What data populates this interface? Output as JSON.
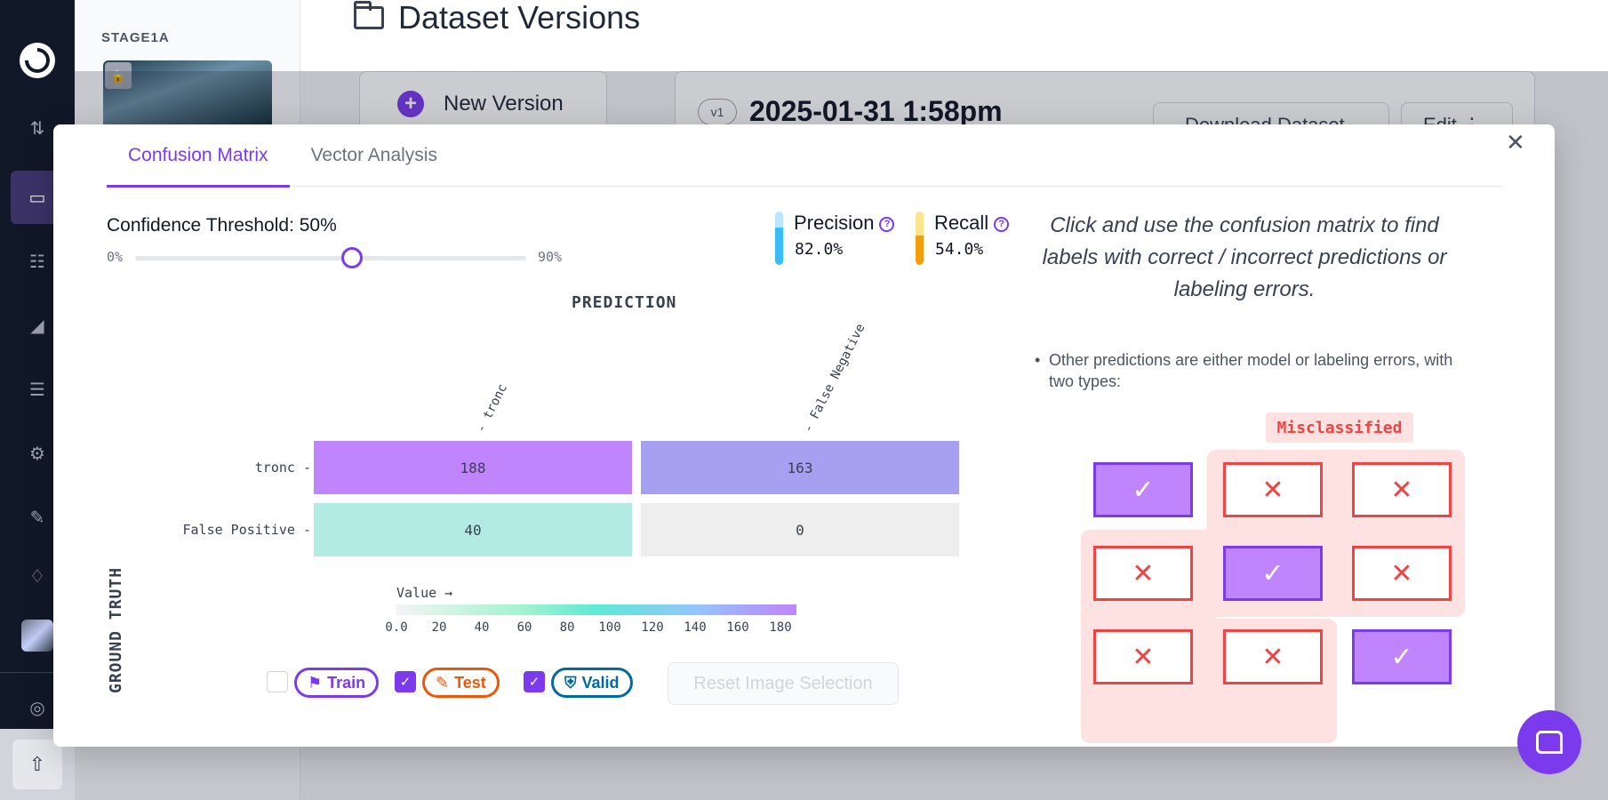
{
  "project": {
    "name": "STAGE1A"
  },
  "page": {
    "title": "Dataset Versions"
  },
  "background": {
    "new_version_label": "New Version",
    "version_badge": "v1",
    "version_date": "2025-01-31 1:58pm",
    "download_label": "Download Dataset",
    "edit_label": "Edit"
  },
  "modal": {
    "tabs": [
      {
        "label": "Confusion Matrix",
        "active": true
      },
      {
        "label": "Vector Analysis",
        "active": false
      }
    ],
    "confidence": {
      "label": "Confidence Threshold: 50%",
      "min_label": "0%",
      "max_label": "90%",
      "value": 50,
      "max": 90
    },
    "precision": {
      "label": "Precision",
      "value": "82.0%",
      "color": "#38bdf8"
    },
    "recall": {
      "label": "Recall",
      "value": "54.0%",
      "color": "#f59e0b"
    },
    "prediction_axis": "PREDICTION",
    "ground_truth_axis": "GROUND TRUTH",
    "scale_label": "Value →",
    "reset_label": "Reset Image Selection",
    "splits": [
      {
        "label": "Train",
        "checked": false,
        "color": "#7c3aed"
      },
      {
        "label": "Test",
        "checked": true,
        "color": "#ea580c"
      },
      {
        "label": "Valid",
        "checked": true,
        "color": "#0369a1"
      }
    ]
  },
  "chart_data": {
    "type": "heatmap",
    "x_labels": [
      "tronc",
      "False Negative"
    ],
    "y_labels": [
      "tronc",
      "False Positive"
    ],
    "values": [
      [
        188,
        163
      ],
      [
        40,
        0
      ]
    ],
    "cell_colors": [
      [
        "#c084fc",
        "#a5a0f0"
      ],
      [
        "#b2ebe3",
        "#eeeeee"
      ]
    ],
    "xlabel": "PREDICTION",
    "ylabel": "GROUND TRUTH",
    "colorbar": {
      "label": "Value →",
      "ticks": [
        "0.0",
        "20",
        "40",
        "60",
        "80",
        "100",
        "120",
        "140",
        "160",
        "180"
      ],
      "range": [
        0,
        188
      ]
    }
  },
  "guide": {
    "heading": "Click and use the confusion matrix to find labels with correct / incorrect predictions or labeling errors.",
    "bullet": "Other predictions are either model or labeling errors, with two types:",
    "misclassified_label": "Misclassified",
    "grid": [
      [
        "ok",
        "bad",
        "bad"
      ],
      [
        "bad",
        "ok",
        "bad"
      ],
      [
        "bad",
        "bad",
        "ok"
      ]
    ]
  },
  "icons": {
    "close": "✕",
    "check": "✓",
    "cross": "✕"
  }
}
